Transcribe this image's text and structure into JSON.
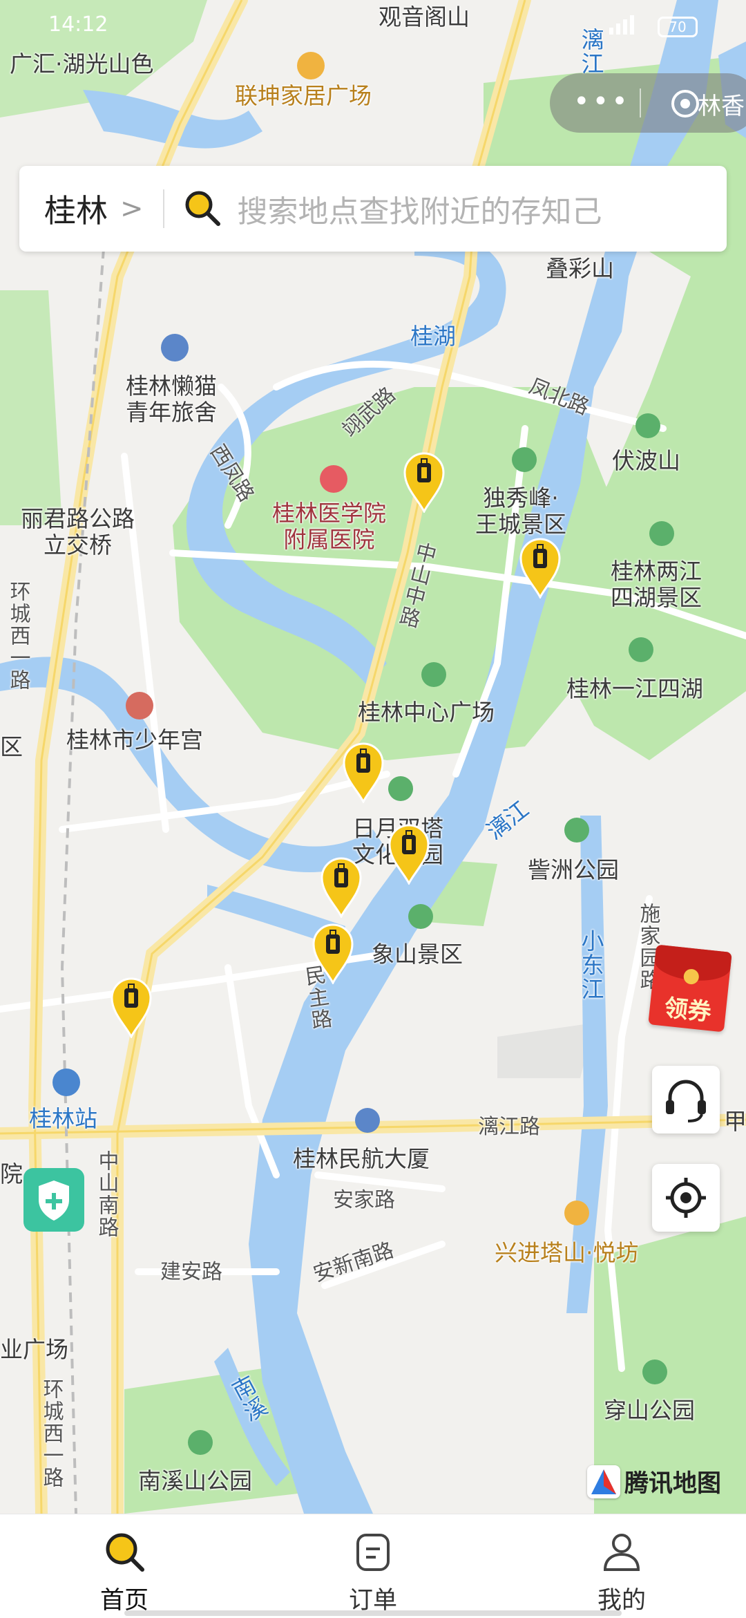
{
  "status_bar": {
    "time": "14:12",
    "battery": "70"
  },
  "capsule": {
    "dots": "•••",
    "right_text": "林香"
  },
  "search": {
    "city": "桂林",
    "chevron": ">",
    "placeholder": "搜索地点查找附近的存知己"
  },
  "map": {
    "labels": {
      "guanyinge": "观音阁山",
      "guanghui": "广汇·湖光山色",
      "liankun": "联坤家居广场",
      "lijiang_top": "漓江",
      "diecaishan": "叠彩山",
      "guihu": "桂湖",
      "lazycat": "桂林懒猫\n青年旅舍",
      "xiangwu_road": "翊武路",
      "fengbei_road": "凤北路",
      "xifan_road": "西凤路",
      "hospital": "桂林医学院\n附属医院",
      "duxiufeng": "独秀峰·\n王城景区",
      "fubo": "伏波山",
      "lijun": "丽君路公路\n立交桥",
      "zhongshan_zhong": "中山中路",
      "liangjiang": "桂林两江\n四湖景区",
      "huancheng_xi": "环城西一路",
      "yijiang": "桂林一江四湖",
      "center_square": "桂林中心广场",
      "youth_palace": "桂林市少年宫",
      "riyue_ta": "日月双塔\n文化公园",
      "lijiang_mid": "漓江",
      "zizhou": "訾洲公园",
      "xiangshan": "象山景区",
      "minzhu": "民主路",
      "xiaodong": "小东江",
      "shijiayuan": "施家园路",
      "guilin_station": "桂林站",
      "lijiang_road": "漓江路",
      "minhang": "桂林民航大厦",
      "zhongshan_nan": "中山南路",
      "anjia": "安家路",
      "anxin_nan": "安新南路",
      "xingjin": "兴进塔山·悦坊",
      "jianan": "建安路",
      "yeguangchang": "业广场",
      "huancheng_xi2": "环城西一路",
      "chuanshan": "穿山公园",
      "nanxi_river": "南溪",
      "nanxishan": "南溪山公园",
      "qu_left": "区",
      "jia_right": "甲",
      "yuan_left": "院"
    }
  },
  "coupon": {
    "label": "领券"
  },
  "map_brand": "腾讯地图",
  "tabs": [
    {
      "label": "首页",
      "icon": "search-icon",
      "active": true
    },
    {
      "label": "订单",
      "icon": "order-icon",
      "active": false
    },
    {
      "label": "我的",
      "icon": "profile-icon",
      "active": false
    }
  ],
  "colors": {
    "accent": "#f5c518",
    "park": "#b9e6ad",
    "water": "#a5cdf3",
    "road_major": "#f9e7a6"
  }
}
